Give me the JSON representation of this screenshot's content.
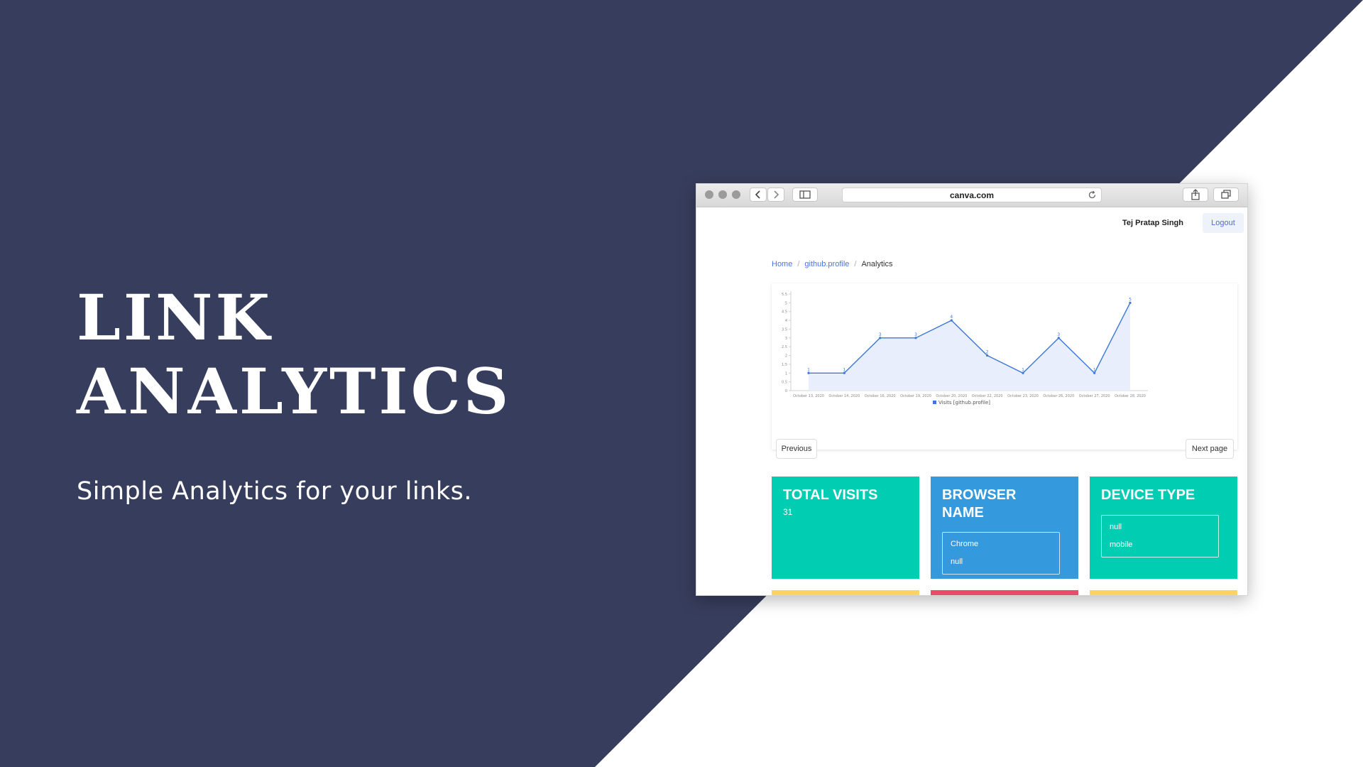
{
  "colors": {
    "navy": "#373d5c",
    "teal": "#00cdb1",
    "blue": "#3599dd",
    "yellow": "#fcd55e",
    "pink": "#e94b6b",
    "line": "#3c78d8"
  },
  "hero": {
    "title_line1": "LINK",
    "title_line2": "ANALYTICS",
    "subtitle": "Simple Analytics for your links."
  },
  "browser": {
    "url": "canva.com",
    "icons": [
      "back-icon",
      "forward-icon",
      "sidebar-icon",
      "reload-icon",
      "share-icon",
      "tabs-icon"
    ]
  },
  "header": {
    "user_name": "Tej Pratap Singh",
    "logout_label": "Logout"
  },
  "breadcrumb": {
    "items": [
      "Home",
      "github.profile",
      "Analytics"
    ]
  },
  "pagination": {
    "previous_label": "Previous",
    "next_label": "Next page"
  },
  "cards": {
    "total_visits": {
      "title": "TOTAL VISITS",
      "value": "31"
    },
    "browser_name": {
      "title_line1": "BROWSER",
      "title_line2": "NAME",
      "items": [
        "Chrome",
        "null"
      ]
    },
    "device_type": {
      "title": "DEVICE TYPE",
      "items": [
        "null",
        "mobile"
      ]
    }
  },
  "chart_data": {
    "type": "area",
    "categories": [
      "October 13, 2020",
      "October 14, 2020",
      "October 16, 2020",
      "October 19, 2020",
      "October 20, 2020",
      "October 22, 2020",
      "October 23, 2020",
      "October 26, 2020",
      "October 27, 2020",
      "October 28, 2020"
    ],
    "series": [
      {
        "name": "Visits [github.profile]",
        "values": [
          1,
          1,
          3,
          3,
          4,
          2,
          1,
          3,
          1,
          5
        ]
      }
    ],
    "y_ticks": [
      "0",
      "0.5",
      "1",
      "1.5",
      "2",
      "2.5",
      "3",
      "3.5",
      "4",
      "4.5",
      "5",
      "5.5"
    ],
    "ylim": [
      0,
      5.5
    ],
    "legend": "bottom",
    "grid": false
  }
}
